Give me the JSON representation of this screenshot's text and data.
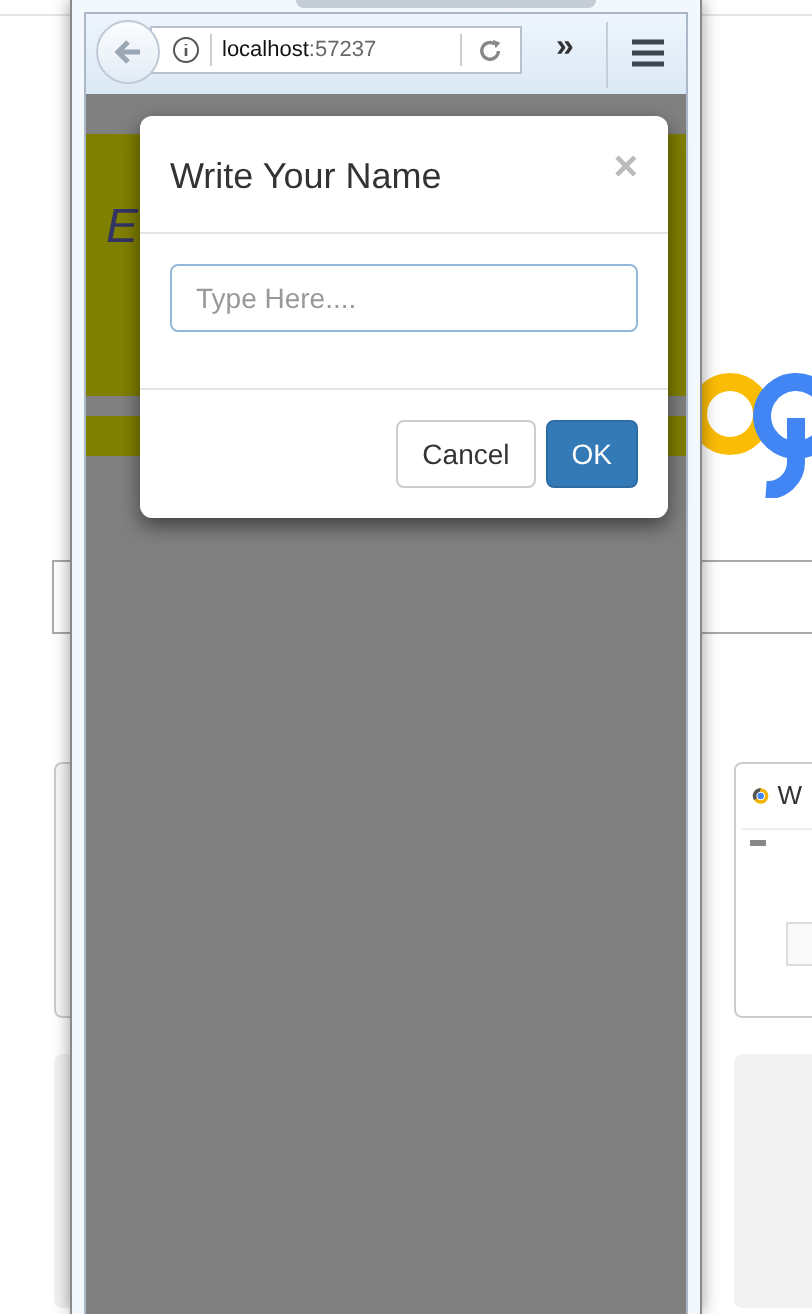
{
  "background_page": {
    "card_title": "W"
  },
  "browser": {
    "address": {
      "host": "localhost",
      "port": ":57237"
    },
    "overflow": "»",
    "page": {
      "banner_text": "E"
    }
  },
  "dialog": {
    "title": "Write Your Name",
    "close": "×",
    "name_field": {
      "placeholder": "Type Here...."
    },
    "buttons": [
      {
        "label": "Cancel",
        "kind": "default"
      },
      {
        "label": "OK",
        "kind": "primary"
      }
    ]
  }
}
